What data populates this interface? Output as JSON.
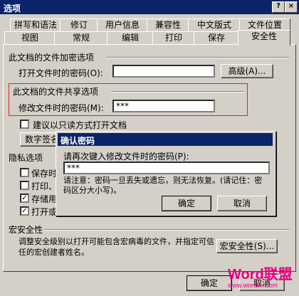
{
  "window": {
    "title": "选项",
    "help_btn": "?",
    "close_btn": "×"
  },
  "tabs_row1": [
    "拼写和语法",
    "修订",
    "用户信息",
    "兼容性",
    "中文版式",
    "文件位置"
  ],
  "tabs_row2": [
    "视图",
    "常规",
    "编辑",
    "打印",
    "保存",
    "安全性"
  ],
  "encrypt": {
    "heading": "此文档的文件加密选项",
    "open_pwd_label": "打开文件时的密码(O):",
    "open_pwd_value": "",
    "advanced_btn": "高级(A)..."
  },
  "share": {
    "heading": "此文档的文件共享选项",
    "modify_pwd_label": "修改文件时的密码(M):",
    "modify_pwd_value": "***"
  },
  "readonly": {
    "label": "建议以只读方式打开文档"
  },
  "digital_btn": "数字签名",
  "privacy": {
    "heading": "隐私选项",
    "items": [
      {
        "label": "保存时",
        "checked": false
      },
      {
        "label": "打印、",
        "checked": false
      },
      {
        "label": "存储用",
        "checked": true
      },
      {
        "label": "打开或",
        "checked": true
      }
    ]
  },
  "macro": {
    "heading": "宏安全性",
    "desc": "调整安全级别以打开可能包含宏病毒的文件，并指定可信任的宏创建者姓名。",
    "btn": "宏安全性(S)..."
  },
  "footer": {
    "ok": "确定",
    "cancel": "取消"
  },
  "confirm": {
    "title": "确认密码",
    "prompt": "请再次键入修改文件时的密码(P):",
    "value": "***",
    "note": "请注意：密码一旦丢失或遗忘，则无法恢复。(请记住：密码区分大小写)。",
    "ok": "确定",
    "cancel": "取消"
  },
  "watermark": {
    "brand": "Word联盟",
    "url": "www.wordlm.com"
  }
}
